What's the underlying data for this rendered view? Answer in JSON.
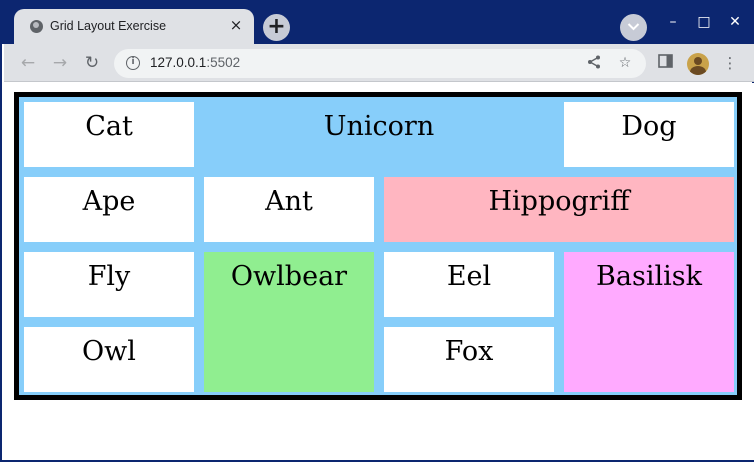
{
  "browser": {
    "tab_title": "Grid Layout Exercise",
    "tab_close_glyph": "×",
    "new_tab_glyph": "+",
    "url_host": "127.0.0.1",
    "url_port": ":5502",
    "window_controls": {
      "minimize_glyph": "–",
      "maximize_glyph": "□",
      "close_glyph": "✕"
    }
  },
  "grid": {
    "border_color": "#000000",
    "background_color": "#87cefa",
    "cells": [
      {
        "label": "Cat",
        "background": "#ffffff"
      },
      {
        "label": "Unicorn",
        "background": "transparent"
      },
      {
        "label": "Dog",
        "background": "#ffffff"
      },
      {
        "label": "Ape",
        "background": "#ffffff"
      },
      {
        "label": "Ant",
        "background": "#ffffff"
      },
      {
        "label": "Hippogriff",
        "background": "#ffb6c1"
      },
      {
        "label": "Fly",
        "background": "#ffffff"
      },
      {
        "label": "Owlbear",
        "background": "#90ee90"
      },
      {
        "label": "Eel",
        "background": "#ffffff"
      },
      {
        "label": "Basilisk",
        "background": "#ffaaff"
      },
      {
        "label": "Owl",
        "background": "#ffffff"
      },
      {
        "label": "Fox",
        "background": "#ffffff"
      }
    ]
  },
  "icons": {
    "tab_favicon": "globe-icon",
    "tab_search": "chevron-down-icon",
    "back": "back-arrow-icon",
    "forward": "forward-arrow-icon",
    "reload": "reload-icon",
    "site_info": "info-icon",
    "share": "share-icon",
    "bookmark": "star-icon",
    "side_panel": "side-panel-icon",
    "profile": "avatar",
    "menu": "kebab-menu-icon"
  }
}
